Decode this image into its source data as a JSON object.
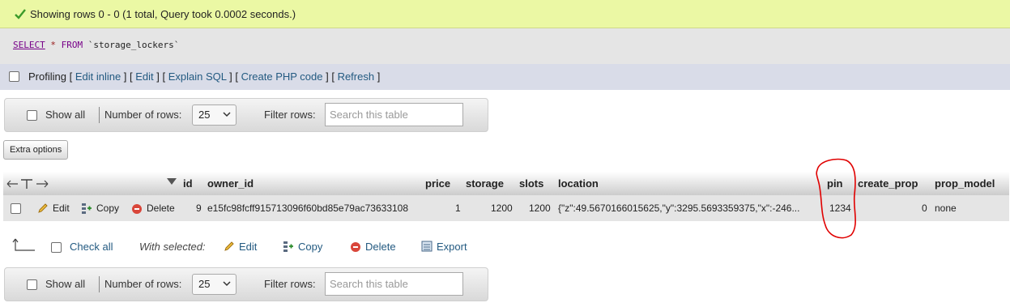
{
  "success": {
    "message": "Showing rows 0 - 0 (1 total, Query took 0.0002 seconds.)"
  },
  "sql": {
    "select": "SELECT",
    "star": "*",
    "from": "FROM",
    "table": "`storage_lockers`"
  },
  "profiling": {
    "label": "Profiling",
    "links": [
      "Edit inline",
      "Edit",
      "Explain SQL",
      "Create PHP code",
      "Refresh"
    ]
  },
  "navigation": {
    "show_all": "Show all",
    "number_of_rows_label": "Number of rows:",
    "rows_value": "25",
    "filter_label": "Filter rows:",
    "search_placeholder": "Search this table"
  },
  "extra_options": "Extra options",
  "table": {
    "columns": [
      "id",
      "owner_id",
      "price",
      "storage",
      "slots",
      "location",
      "pin",
      "create_prop",
      "prop_model"
    ],
    "row_actions": [
      "Edit",
      "Copy",
      "Delete"
    ],
    "row": {
      "id": "9",
      "owner_id": "e15fc98fcff915713096f60bd85e79ac73633108",
      "price": "1",
      "storage": "1200",
      "slots": "1200",
      "location": "{\"z\":49.5670166015625,\"y\":3295.5693359375,\"x\":-246...",
      "pin": "1234",
      "create_prop": "0",
      "prop_model": "none"
    }
  },
  "bulk": {
    "check_all": "Check all",
    "with_selected": "With selected:",
    "actions": [
      "Edit",
      "Copy",
      "Delete",
      "Export"
    ]
  },
  "colors": {
    "success_bg": "#ebf8a4",
    "link": "#235a81",
    "annotation": "#e00000"
  }
}
